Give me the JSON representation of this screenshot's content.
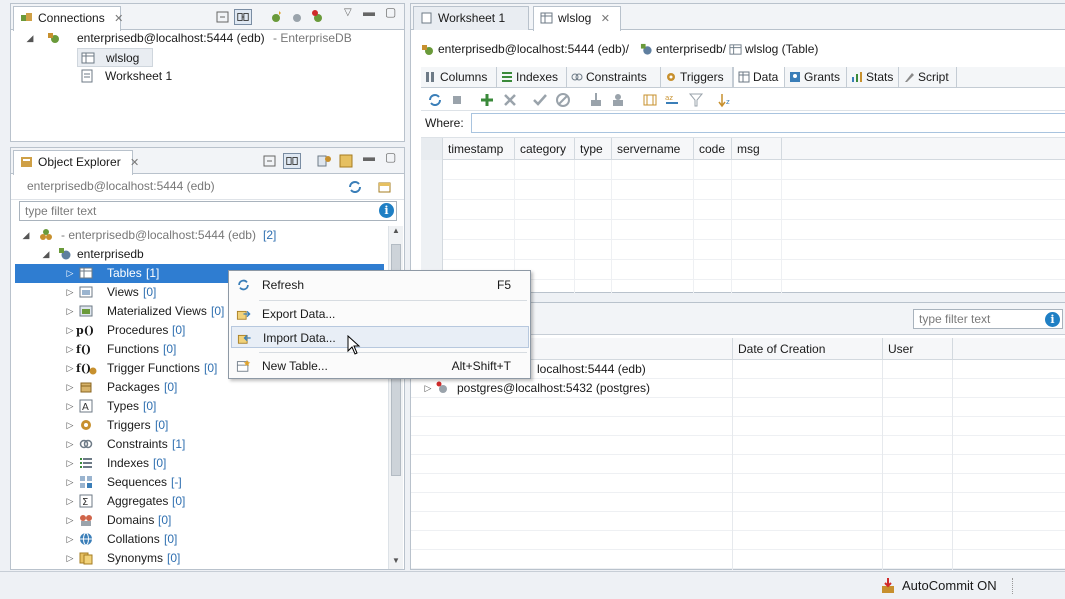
{
  "connections": {
    "tab_label": "Connections",
    "close": "✕",
    "tree": {
      "root": "enterprisedb@localhost:5444 (edb)",
      "root_suffix": " - EnterpriseDB",
      "children": [
        "wlslog",
        "Worksheet 1"
      ]
    }
  },
  "object_explorer": {
    "tab_label": "Object Explorer",
    "close": "✕",
    "connection_label": "enterprisedb@localhost:5444 (edb)",
    "filter_placeholder": "type filter text",
    "tree_root": "- enterprisedb@localhost:5444 (edb)",
    "tree_root_count": "[2]",
    "database": "enterprisedb",
    "items": [
      {
        "label": "Tables",
        "count": "[1]"
      },
      {
        "label": "Views",
        "count": "[0]"
      },
      {
        "label": "Materialized Views",
        "count": "[0]"
      },
      {
        "label": "Procedures",
        "count": "[0]"
      },
      {
        "label": "Functions",
        "count": "[0]"
      },
      {
        "label": "Trigger Functions",
        "count": "[0]"
      },
      {
        "label": "Packages",
        "count": "[0]"
      },
      {
        "label": "Types",
        "count": "[0]"
      },
      {
        "label": "Triggers",
        "count": "[0]"
      },
      {
        "label": "Constraints",
        "count": "[1]"
      },
      {
        "label": "Indexes",
        "count": "[0]"
      },
      {
        "label": "Sequences",
        "count": "[-]"
      },
      {
        "label": "Aggregates",
        "count": "[0]"
      },
      {
        "label": "Domains",
        "count": "[0]"
      },
      {
        "label": "Collations",
        "count": "[0]"
      },
      {
        "label": "Synonyms",
        "count": "[0]"
      }
    ],
    "icon_glyphs": {
      "procedures": "p()",
      "functions": "f()",
      "trigger_functions": "f()"
    }
  },
  "editor": {
    "tabs": [
      {
        "label": "Worksheet 1",
        "close": ""
      },
      {
        "label": "wlslog",
        "close": "✕"
      }
    ],
    "breadcrumb": {
      "connection": "enterprisedb@localhost:5444 (edb)/",
      "database": "enterprisedb/",
      "table": "wlslog (Table)"
    },
    "subtabs": [
      "Columns",
      "Indexes",
      "Constraints",
      "Triggers",
      "Data",
      "Grants",
      "Stats",
      "Script"
    ],
    "active_subtab": "Data",
    "where_label": "Where:",
    "columns": [
      "timestamp",
      "category",
      "type",
      "servername",
      "code",
      "msg"
    ]
  },
  "bottom_panel": {
    "filter_placeholder": "type filter text",
    "columns": {
      "date": "Date of Creation",
      "user": "User"
    },
    "rows": [
      "localhost:5444 (edb)",
      "postgres@localhost:5432 (postgres)"
    ]
  },
  "context_menu": {
    "items": [
      {
        "label": "Refresh",
        "shortcut": "F5"
      },
      {
        "label": "Export Data...",
        "shortcut": ""
      },
      {
        "label": "Import Data...",
        "shortcut": ""
      },
      {
        "label": "New Table...",
        "shortcut": "Alt+Shift+T"
      }
    ],
    "highlighted_index": 2
  },
  "status_bar": {
    "autocommit": "AutoCommit ON"
  },
  "colors": {
    "selection": "#2f7dd1",
    "count_blue": "#2f6fb0",
    "info_blue": "#1f7fc4"
  }
}
